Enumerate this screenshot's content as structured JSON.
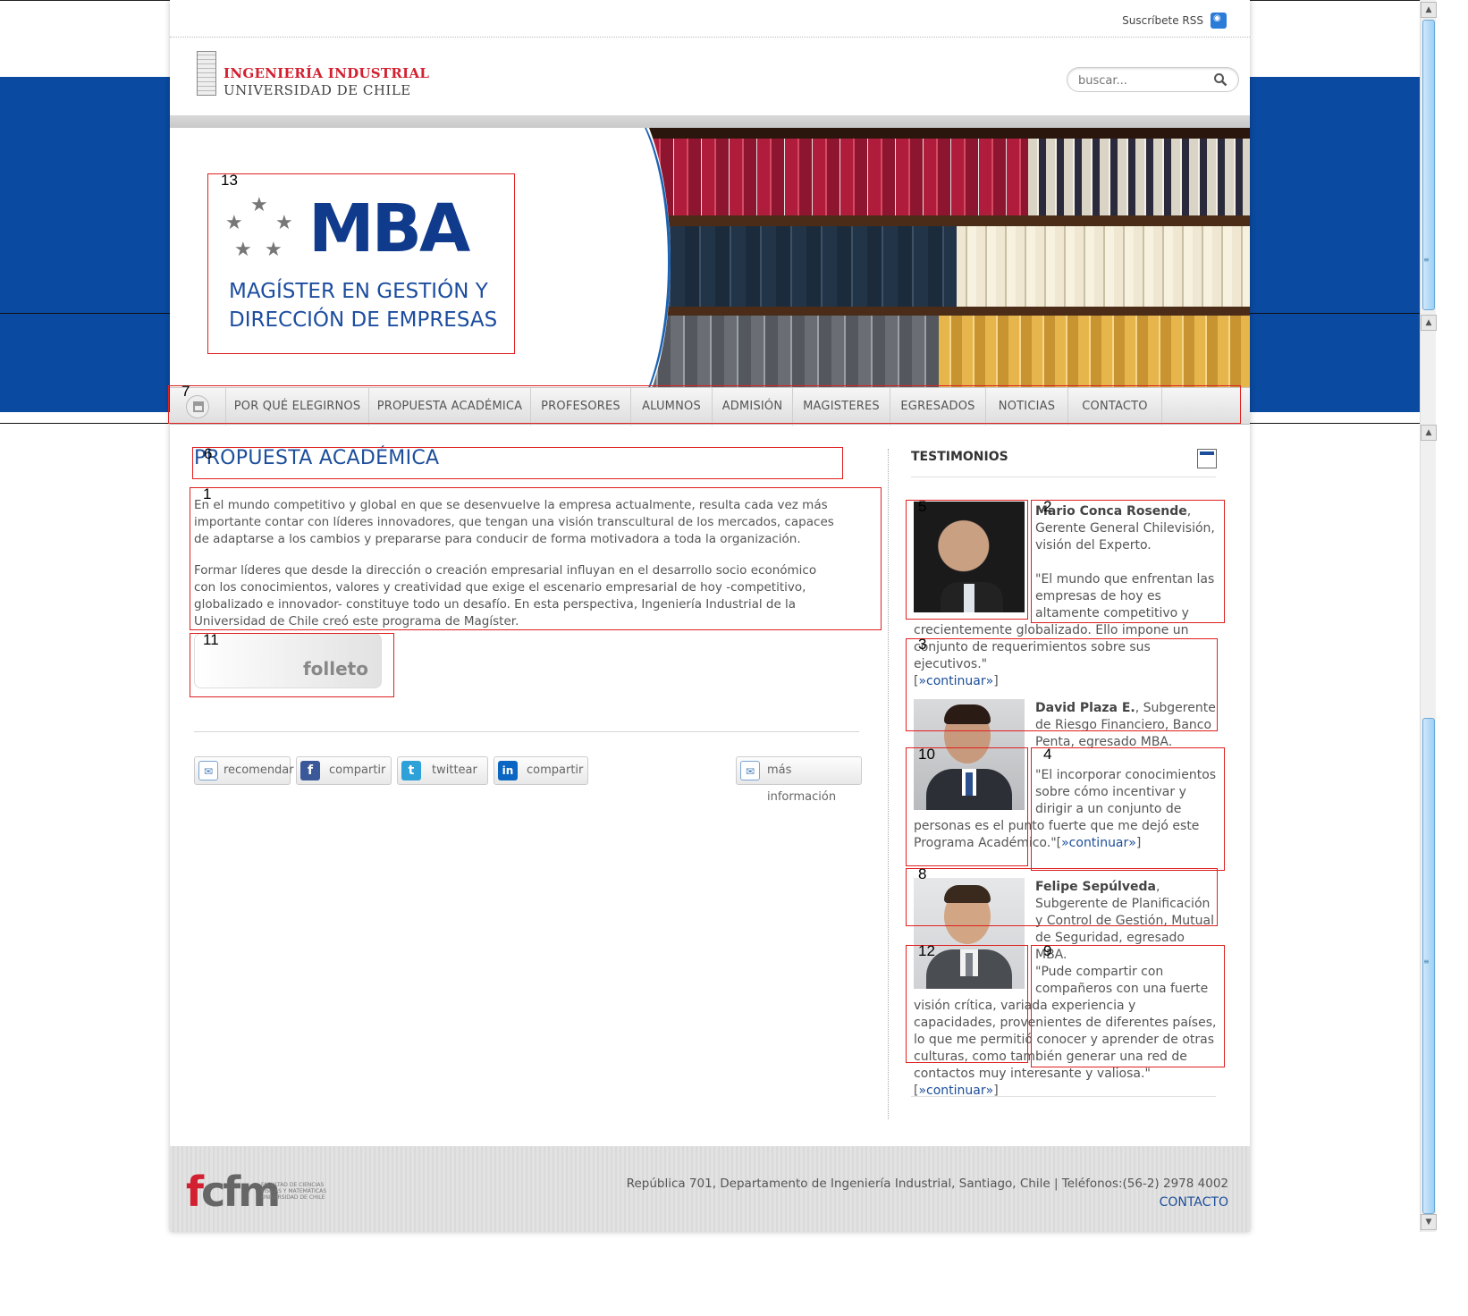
{
  "topbar": {
    "rss_label": "Suscríbete RSS"
  },
  "header": {
    "logo_line1": "INGENIERÍA INDUSTRIAL",
    "logo_line2": "UNIVERSIDAD DE CHILE",
    "search_placeholder": "buscar..."
  },
  "hero": {
    "mba": "MBA",
    "sub1": "MAGÍSTER EN GESTIÓN Y",
    "sub2": "DIRECCIÓN DE EMPRESAS"
  },
  "nav": {
    "items": [
      "POR QUÉ ELEGIRNOS",
      "PROPUESTA ACADÉMICA",
      "PROFESORES",
      "ALUMNOS",
      "ADMISIÓN",
      "MAGISTERES",
      "EGRESADOS",
      "NOTICIAS",
      "CONTACTO"
    ]
  },
  "main": {
    "title": "PROPUESTA ACADÉMICA",
    "p1": "En el mundo competitivo y global en que se desenvuelve la empresa actualmente, resulta cada vez más importante contar con líderes innovadores, que tengan una visión transcultural de los mercados, capaces de adaptarse a los cambios y prepararse para conducir de forma motivadora a toda la organización.",
    "p2": "Formar líderes que desde la dirección o creación empresarial influyan en el desarrollo socio económico con los conocimientos, valores y creatividad que exige el escenario empresarial de hoy -competitivo, globalizado e innovador- constituye todo un desafío. En esta perspectiva, Ingeniería Industrial de la Universidad de Chile creó este programa de Magíster.",
    "folleto": "folleto",
    "share": {
      "recomendar": "recomendar",
      "facebook": "compartir",
      "twitter": "twittear",
      "linkedin": "compartir",
      "mas_info": "más información"
    }
  },
  "sidebar": {
    "title": "TESTIMONIOS",
    "t1": {
      "name": "Mario Conca Rosende",
      "role": ", Gerente General Chilevisión, visión del Experto.",
      "quote_a": "\"El mundo que enfrentan las empresas de hoy es altamente competitivo y",
      "quote_b": "crecientemente globalizado. Ello impone un conjunto de requerimientos sobre sus ejecutivos.\"",
      "link": "»continuar»"
    },
    "t2": {
      "name": "David Plaza E.",
      "role": ", Subgerente de Riesgo Financiero, Banco Penta, egresado MBA.",
      "quote_a": "\"El incorporar conocimientos sobre cómo incentivar y dirigir a un conjunto de",
      "quote_b": "personas es el punto fuerte que me dejó este Programa Académico.\"",
      "link": "»continuar»"
    },
    "t3": {
      "name": "Felipe Sepúlveda",
      "role": ", Subgerente de Planificación y Control de Gestión, Mutual de Seguridad, egresado MBA.",
      "quote_a": "\"Pude compartir con compañeros con una fuerte",
      "quote_b": "visión crítica, variada experiencia y capacidades, provenientes de diferentes países, lo que me permitió conocer y aprender de otras culturas, como también generar una red de contactos muy interesante y valiosa.\"",
      "link": "»continuar»"
    }
  },
  "footer": {
    "logo": "fcfm",
    "logo_small": "FACULTAD DE CIENCIAS FÍSICAS Y MATEMÁTICAS UNIVERSIDAD DE CHILE",
    "address": "República 701, Departamento de Ingeniería Industrial, Santiago, Chile | Teléfonos:(56-2) 2978 4002",
    "contact": "CONTACTO"
  },
  "annotations": [
    "1",
    "2",
    "3",
    "4",
    "5",
    "6",
    "7",
    "8",
    "9",
    "10",
    "11",
    "12",
    "13"
  ],
  "colors": {
    "brand_blue": "#0a4aa0",
    "link_blue": "#1c4e9a",
    "logo_red": "#d32030"
  }
}
